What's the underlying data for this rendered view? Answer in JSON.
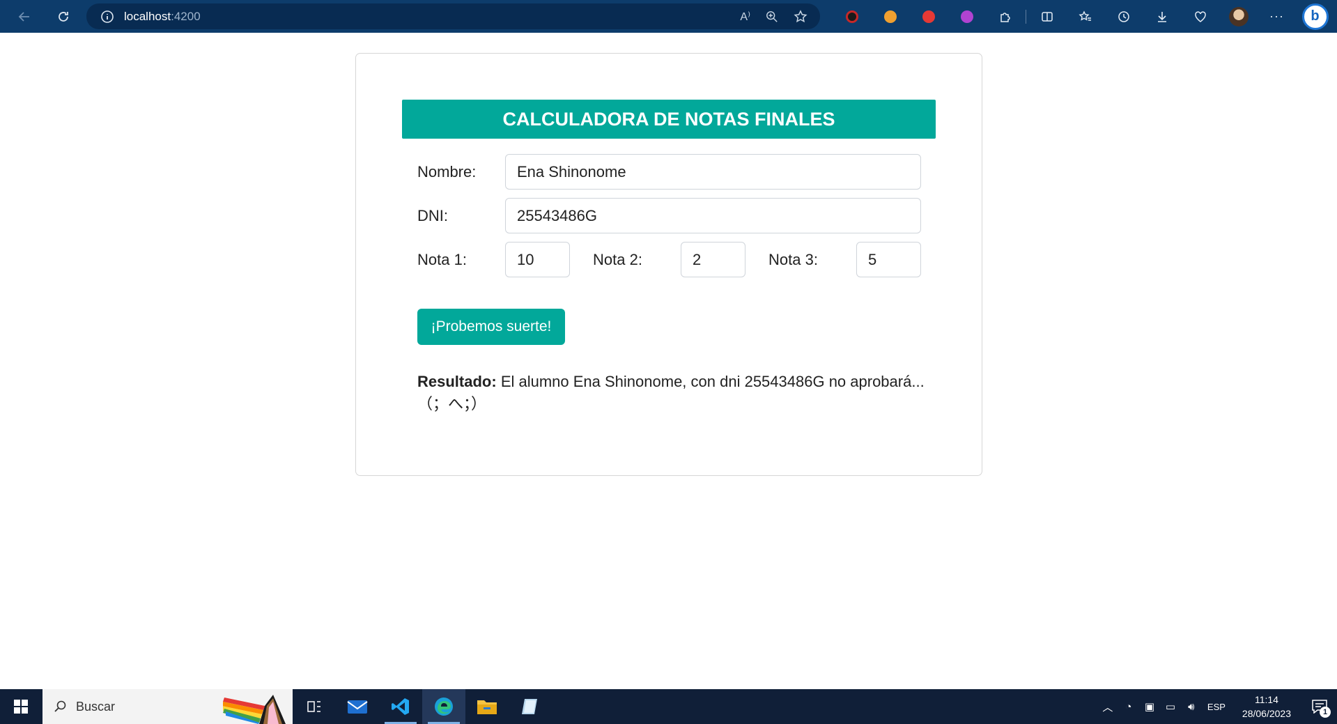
{
  "browser": {
    "url_host": "localhost",
    "url_port": ":4200"
  },
  "app": {
    "title": "CALCULADORA DE NOTAS FINALES",
    "labels": {
      "nombre": "Nombre:",
      "dni": "DNI:",
      "nota1": "Nota 1:",
      "nota2": "Nota 2:",
      "nota3": "Nota 3:"
    },
    "values": {
      "nombre": "Ena Shinonome",
      "dni": "25543486G",
      "nota1": "10",
      "nota2": "2",
      "nota3": "5"
    },
    "button_label": "¡Probemos suerte!",
    "result_label": "Resultado:",
    "result_text": "El alumno Ena Shinonome, con dni 25543486G no aprobará... （；へ；）"
  },
  "taskbar": {
    "search_placeholder": "Buscar",
    "language": "ESP",
    "time": "11:14",
    "date": "28/06/2023",
    "notification_count": "1"
  },
  "colors": {
    "accent": "#02a89a",
    "browser_bar": "#0d3c6b",
    "taskbar": "#101f38"
  }
}
